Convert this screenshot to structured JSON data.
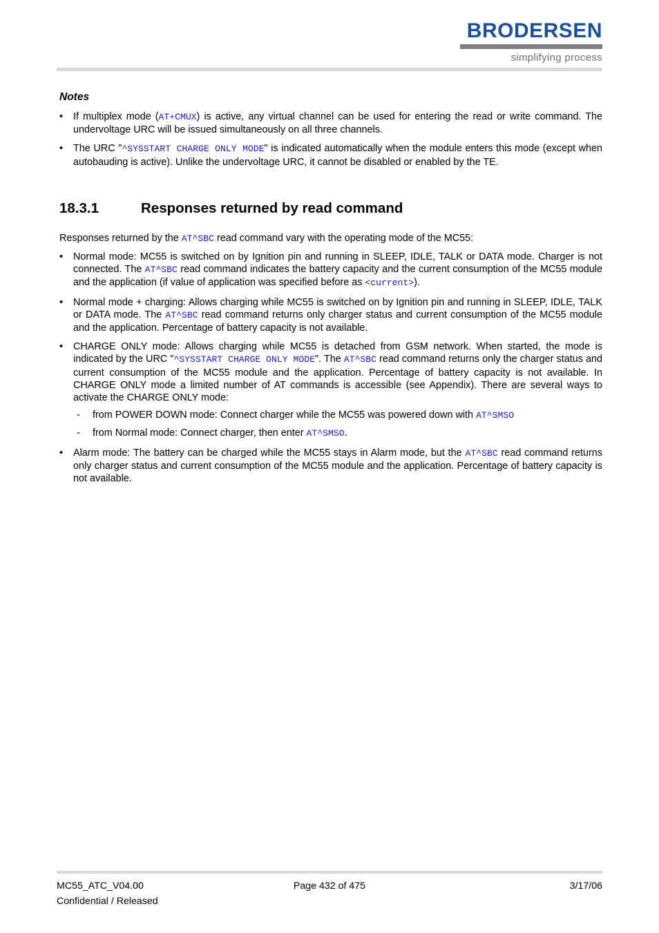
{
  "header": {
    "logo_wordmark": "BRODERSEN",
    "logo_tagline": "simplifying process",
    "logo_color": "#1a4f9c",
    "rule_color": "#d9d9d9"
  },
  "notes": {
    "title": "Notes",
    "bullet_marker": "•",
    "items": [
      {
        "parts": [
          {
            "type": "text",
            "value": "If multiplex mode ("
          },
          {
            "type": "code",
            "value": "AT+CMUX"
          },
          {
            "type": "text",
            "value": ") is active, any virtual channel can be used for entering the read or write command. The undervoltage URC will be issued simultaneously on all three channels."
          }
        ]
      },
      {
        "parts": [
          {
            "type": "text",
            "value": "The URC \""
          },
          {
            "type": "code",
            "value": "^SYSSTART CHARGE ONLY MODE"
          },
          {
            "type": "text",
            "value": "\" is indicated automatically when the module enters this mode (except when autobauding is active). Unlike the undervoltage URC, it cannot be disabled or enabled by the TE."
          }
        ]
      }
    ]
  },
  "section": {
    "number": "18.3.1",
    "title": "Responses returned by read command",
    "intro": {
      "parts": [
        {
          "type": "text",
          "value": "Responses returned by the "
        },
        {
          "type": "code",
          "value": "AT^SBC"
        },
        {
          "type": "text",
          "value": " read command vary with the operating mode of the MC55:"
        }
      ]
    },
    "bullet_marker": "•",
    "dash_marker": "-",
    "items": [
      {
        "parts": [
          {
            "type": "text",
            "value": "Normal mode: MC55 is switched on by Ignition pin and running in SLEEP, IDLE, TALK or DATA mode. Charger is not connected. The "
          },
          {
            "type": "code",
            "value": "AT^SBC"
          },
          {
            "type": "text",
            "value": " read command indicates the battery capacity and the current consumption of the MC55 module and the application (if value of application was specified before as "
          },
          {
            "type": "code",
            "value": "<current>"
          },
          {
            "type": "text",
            "value": ")."
          }
        ]
      },
      {
        "parts": [
          {
            "type": "text",
            "value": "Normal mode + charging: Allows charging while MC55 is switched on by Ignition pin and running in SLEEP, IDLE, TALK or DATA mode. The "
          },
          {
            "type": "code",
            "value": "AT^SBC"
          },
          {
            "type": "text",
            "value": " read command returns only charger status and current consumption of the MC55 module and the application. Percentage of battery capacity is not available."
          }
        ]
      },
      {
        "parts": [
          {
            "type": "text",
            "value": "CHARGE ONLY mode: Allows charging while MC55 is detached from GSM network. When started, the mode is indicated by the URC \""
          },
          {
            "type": "code",
            "value": "^SYSSTART CHARGE ONLY MODE"
          },
          {
            "type": "text",
            "value": "\". The "
          },
          {
            "type": "code",
            "value": "AT^SBC"
          },
          {
            "type": "text",
            "value": " read command returns only the charger status and current consumption of the MC55 module and the application. Percentage of battery capacity is not available. In CHARGE ONLY mode a limited number of AT commands is accessible (see Appendix). There are several ways to activate the CHARGE ONLY mode:"
          }
        ],
        "subitems": [
          {
            "parts": [
              {
                "type": "text",
                "value": "from POWER DOWN mode: Connect charger while the MC55 was powered down with "
              },
              {
                "type": "code",
                "value": "AT^SMSO"
              }
            ]
          },
          {
            "parts": [
              {
                "type": "text",
                "value": "from Normal mode: Connect charger, then enter "
              },
              {
                "type": "code",
                "value": "AT^SMSO"
              },
              {
                "type": "text",
                "value": "."
              }
            ]
          }
        ]
      },
      {
        "parts": [
          {
            "type": "text",
            "value": "Alarm mode: The battery can be charged while the MC55 stays in Alarm mode, but the "
          },
          {
            "type": "code",
            "value": "AT^SBC"
          },
          {
            "type": "text",
            "value": " read command returns only charger status and current consumption of the MC55 module and the application. Percentage of battery capacity is not available."
          }
        ]
      }
    ]
  },
  "footer": {
    "document_id": "MC55_ATC_V04.00",
    "classification": "Confidential / Released",
    "page_label": "Page 432 of 475",
    "date": "3/17/06"
  }
}
